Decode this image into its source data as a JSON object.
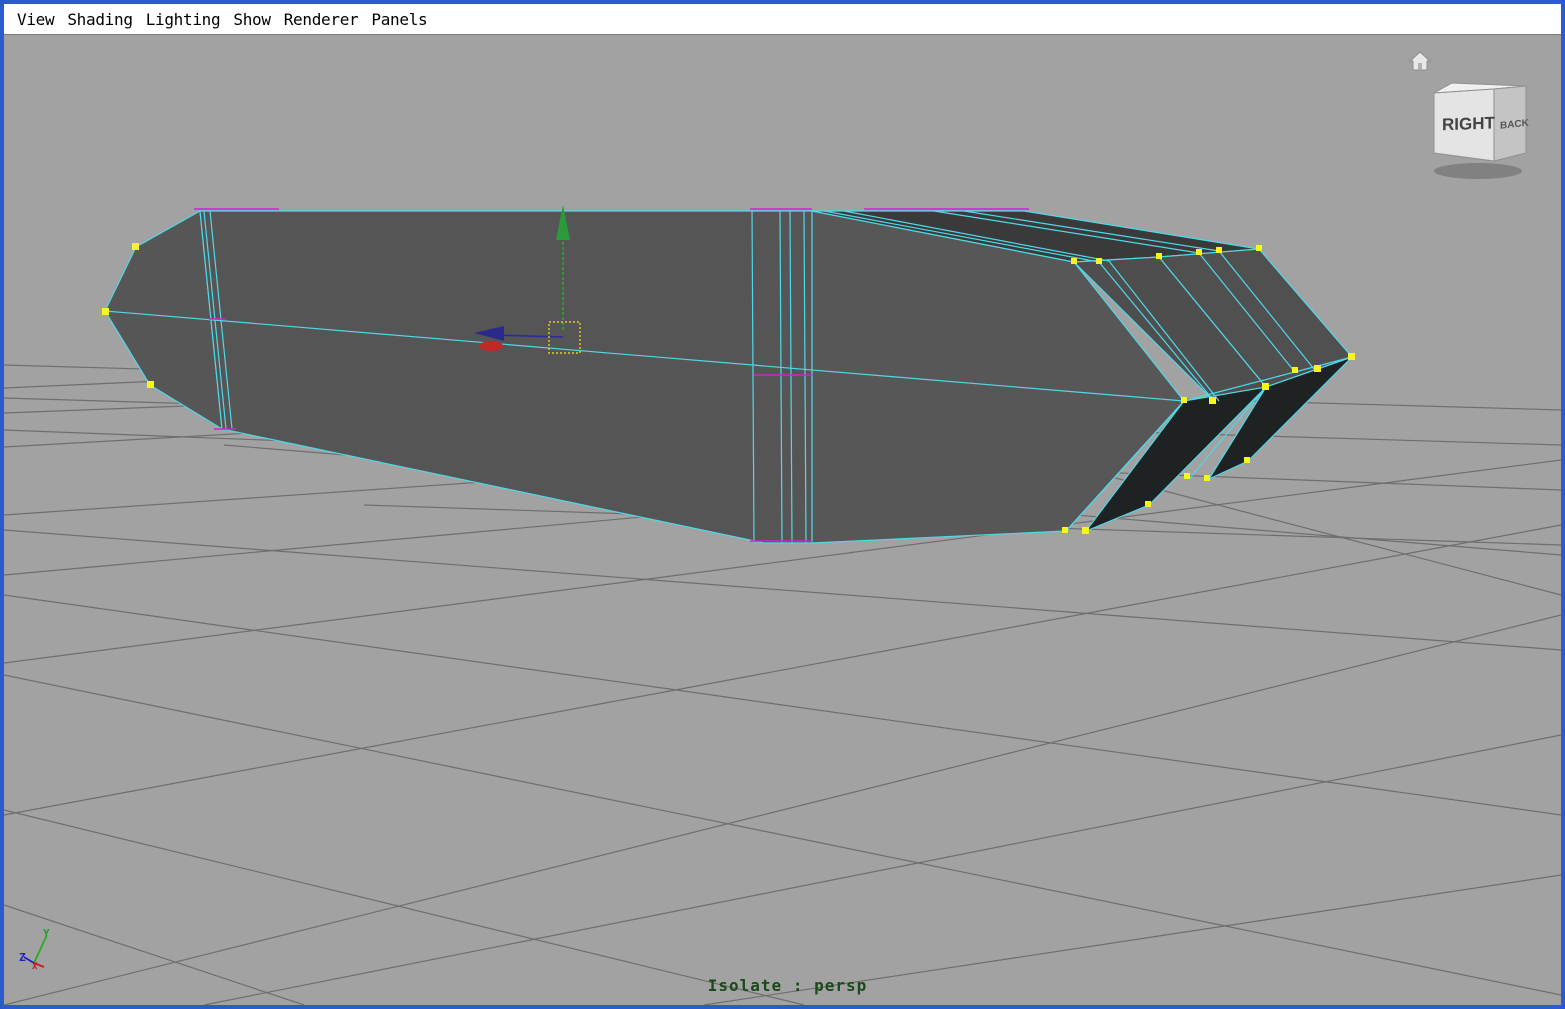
{
  "menubar": {
    "items": [
      {
        "label": "View"
      },
      {
        "label": "Shading"
      },
      {
        "label": "Lighting"
      },
      {
        "label": "Show"
      },
      {
        "label": "Renderer"
      },
      {
        "label": "Panels"
      }
    ]
  },
  "viewcube": {
    "front_label": "RIGHT",
    "side_label": "BACK"
  },
  "axis_indicator": {
    "y_label": "Y",
    "z_label": "Z",
    "x_label": "X"
  },
  "viewport": {
    "status_text": "Isolate : persp"
  },
  "colors": {
    "viewport_bg": "#a2a2a2",
    "grid_line": "#6e6e6e",
    "mesh_face": "#555555",
    "mesh_dark": "#1e2222",
    "wireframe_selected": "#4fd8e8",
    "vertex_selected": "#f5f520",
    "edge_marker": "#d020d0",
    "window_border": "#2a5bd0"
  },
  "icons": {
    "home": "home-icon",
    "viewcube": "viewcube",
    "axis": "axis-indicator-icon",
    "manipulator": "move-manipulator"
  }
}
